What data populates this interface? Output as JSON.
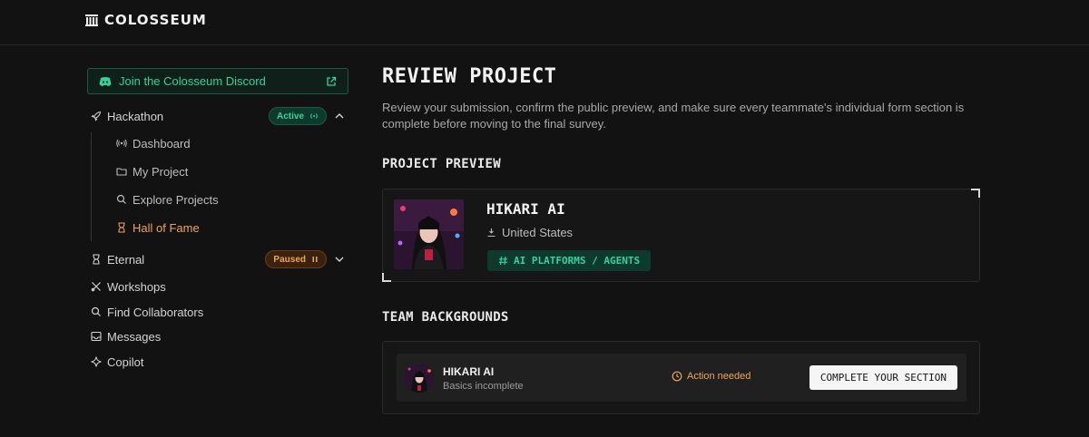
{
  "app": {
    "name": "COLOSSEUM"
  },
  "sidebar": {
    "discord_label": "Join the Colosseum Discord",
    "hackathon": {
      "label": "Hackathon",
      "badge": "Active"
    },
    "hackathon_items": [
      {
        "label": "Dashboard",
        "icon": "broadcast-icon"
      },
      {
        "label": "My Project",
        "icon": "folder-icon"
      },
      {
        "label": "Explore Projects",
        "icon": "search-icon"
      },
      {
        "label": "Hall of Fame",
        "icon": "hourglass-icon"
      }
    ],
    "eternal": {
      "label": "Eternal",
      "badge": "Paused"
    },
    "items": [
      {
        "label": "Workshops",
        "icon": "tools-icon"
      },
      {
        "label": "Find Collaborators",
        "icon": "search-icon"
      },
      {
        "label": "Messages",
        "icon": "inbox-icon"
      },
      {
        "label": "Copilot",
        "icon": "sparkle-icon"
      }
    ]
  },
  "main": {
    "title": "REVIEW PROJECT",
    "description": "Review your submission, confirm the public preview, and make sure every teammate's individual form section is complete before moving to the final survey.",
    "preview_heading": "PROJECT PREVIEW",
    "project": {
      "name": "HIKARI AI",
      "location": "United States",
      "tag": "AI PLATFORMS / AGENTS"
    },
    "team_heading": "TEAM BACKGROUNDS",
    "team": [
      {
        "name": "HIKARI AI",
        "status": "Basics incomplete",
        "action": "Action needed",
        "button": "COMPLETE YOUR SECTION"
      }
    ]
  },
  "colors": {
    "accent_green": "#34d399",
    "accent_orange": "#f0a35c",
    "background": "#121212"
  }
}
